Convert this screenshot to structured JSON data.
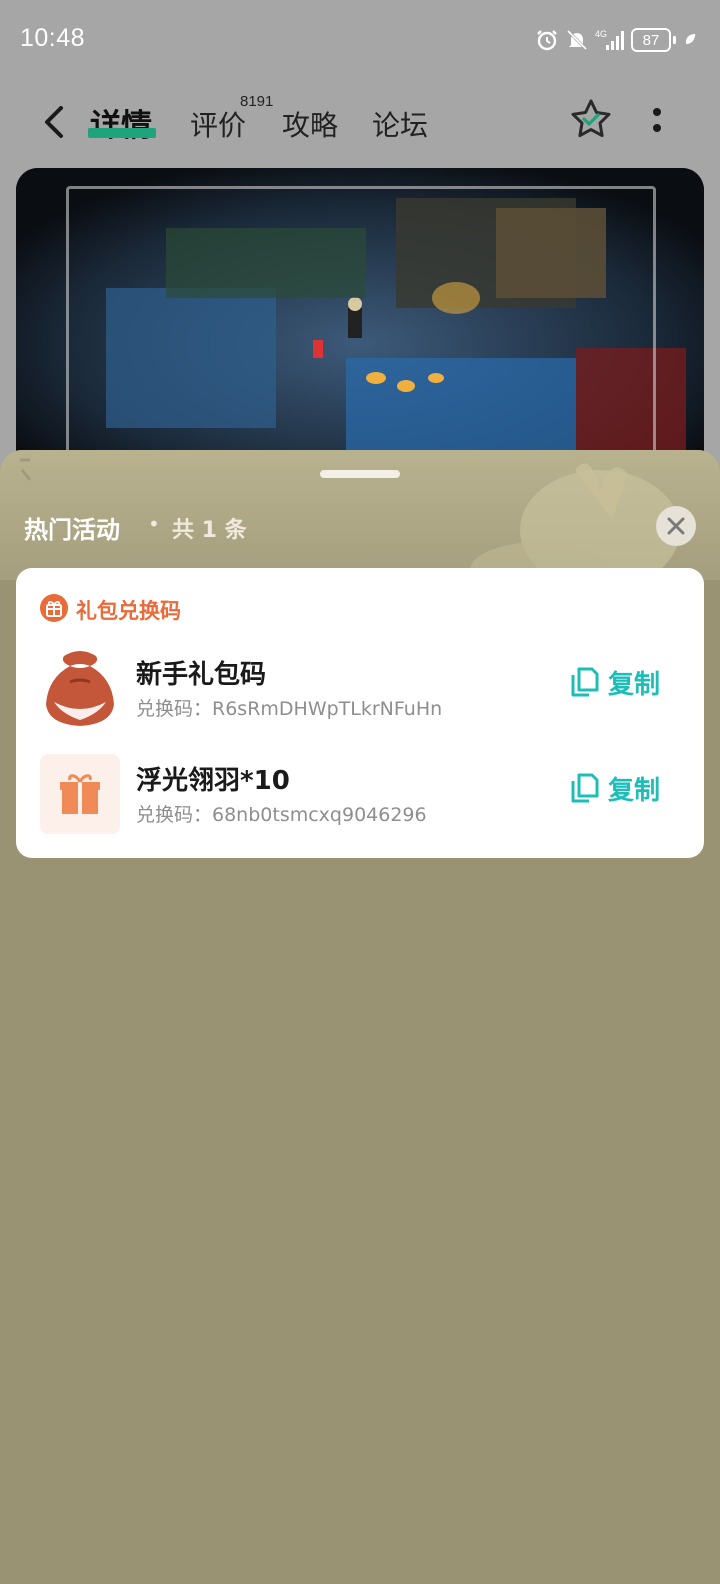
{
  "status_bar": {
    "time": "10:48",
    "battery": "87",
    "network": "4G"
  },
  "nav": {
    "tabs": [
      {
        "label": "详情"
      },
      {
        "label": "评价"
      },
      {
        "label": "攻略"
      },
      {
        "label": "论坛"
      }
    ],
    "review_badge": "8191",
    "icons": [
      "back-icon",
      "star-check-icon",
      "more-vertical-icon"
    ]
  },
  "sheet": {
    "title": "热门活动",
    "dot": "•",
    "count_text": "共 1 条",
    "card": {
      "heading": "礼包兑换码",
      "gifts": [
        {
          "name": "新手礼包码",
          "code": "兑换码：R6sRmDHWpTLkrNFuHn",
          "copy_label": "复制",
          "icon": "gift-bag-icon"
        },
        {
          "name": "浮光翎羽*10",
          "code": "兑换码：68nb0tsmcxq9046296",
          "copy_label": "复制",
          "icon": "gift-box-icon"
        }
      ]
    }
  },
  "colors": {
    "accent_green": "#1fa37d",
    "accent_orange": "#ea6a3a",
    "copy_teal": "#1dbeb8",
    "sheet_bg": "#9a9373"
  }
}
